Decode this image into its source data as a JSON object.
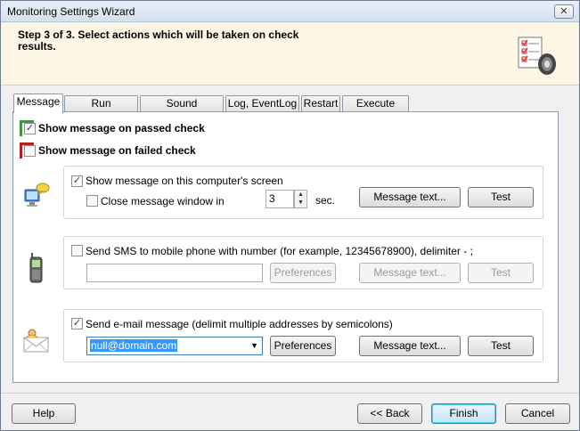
{
  "window": {
    "title": "Monitoring Settings Wizard",
    "close_glyph": "✕"
  },
  "header": {
    "step_text": "Step 3 of 3. Select actions which will be taken on check results.",
    "icon": "checklist-speaker-icon"
  },
  "tabs": [
    {
      "label": "Message",
      "active": true
    },
    {
      "label": "Run application",
      "active": false
    },
    {
      "label": "Sound notification",
      "active": false
    },
    {
      "label": "Log, EventLog",
      "active": false
    },
    {
      "label": "Restart",
      "active": false
    },
    {
      "label": "Execute script",
      "active": false
    }
  ],
  "message_tab": {
    "show_on_passed": {
      "label": "Show message on passed check",
      "checked": true,
      "flag_color": "#3a9a3a"
    },
    "show_on_failed": {
      "label": "Show message on failed check",
      "checked": false,
      "flag_color": "#b22222"
    },
    "screen_group": {
      "icon": "computer-message-icon",
      "show_on_screen": {
        "label": "Show message on this computer's screen",
        "checked": true
      },
      "close_window": {
        "label": "Close message window in",
        "checked": false,
        "value": "3",
        "unit": "sec."
      },
      "message_text_button": "Message text...",
      "test_button": "Test"
    },
    "sms_group": {
      "icon": "mobile-phone-icon",
      "send_sms": {
        "label": "Send SMS to mobile phone with number (for example, 12345678900), delimiter - ;",
        "checked": false
      },
      "phone_value": "",
      "preferences_button": "Preferences",
      "message_text_button": "Message text...",
      "test_button": "Test"
    },
    "email_group": {
      "icon": "envelope-person-icon",
      "send_email": {
        "label": "Send e-mail message (delimit multiple addresses by semicolons)",
        "checked": true
      },
      "email_value": "null@domain.com",
      "preferences_button": "Preferences",
      "message_text_button": "Message text...",
      "test_button": "Test"
    }
  },
  "footer": {
    "help_button": "Help",
    "back_button": "<< Back",
    "finish_button": "Finish",
    "cancel_button": "Cancel"
  }
}
